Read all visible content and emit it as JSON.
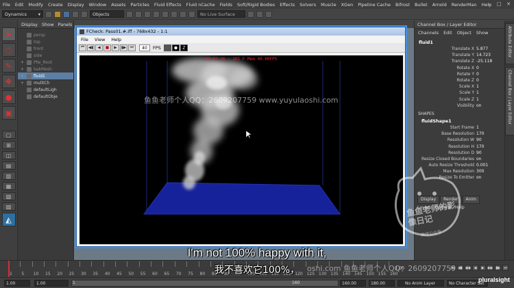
{
  "menubar": {
    "items": [
      "File",
      "Edit",
      "Modify",
      "Create",
      "Display",
      "Window",
      "Assets",
      "Particles",
      "Fluid Effects",
      "Fluid nCache",
      "Fields",
      "Soft/Rigid Bodies",
      "Effects",
      "Solvers",
      "Muscle",
      "XGen",
      "Pipeline Cache",
      "Bifrost",
      "Bullet",
      "Arnold",
      "RenderMan",
      "Help"
    ]
  },
  "statusline": {
    "menuset": "Dynamics",
    "selection_mode": "Objects",
    "live_surface": "No Live Surface"
  },
  "outliner": {
    "menu": [
      "Display",
      "Show",
      "Panels"
    ],
    "items": [
      {
        "label": "persp",
        "dim": true
      },
      {
        "label": "top",
        "dim": true
      },
      {
        "label": "front",
        "dim": true
      },
      {
        "label": "side",
        "dim": true
      },
      {
        "label": "Pfw_Root",
        "dim": true
      },
      {
        "label": "bakMesh",
        "dim": true
      },
      {
        "label": "fluid1",
        "dim": false
      },
      {
        "label": "mulitCh",
        "dim": false
      },
      {
        "label": "defaultLigh",
        "dim": false
      },
      {
        "label": "defaultObje",
        "dim": false
      }
    ]
  },
  "fcheck": {
    "title": "FCheck: Pass01.#.iff - 768x432 - 1:1",
    "menu": [
      "File",
      "View",
      "Help"
    ],
    "fps_value": "40",
    "fps_label": "FPS",
    "info": "00:02:26 - 101 F Mem 40.00FPS"
  },
  "channelbox": {
    "header": "Channel Box / Layer Editor",
    "menu": [
      "Channels",
      "Edit",
      "Object",
      "Show"
    ],
    "node": "fluid1",
    "attrs": [
      {
        "label": "Translate X",
        "value": "5.877"
      },
      {
        "label": "Translate Y",
        "value": "14.723"
      },
      {
        "label": "Translate Z",
        "value": "-25.118"
      },
      {
        "label": "Rotate X",
        "value": "0"
      },
      {
        "label": "Rotate Y",
        "value": "0"
      },
      {
        "label": "Rotate Z",
        "value": "0"
      },
      {
        "label": "Scale X",
        "value": "1"
      },
      {
        "label": "Scale Y",
        "value": "1"
      },
      {
        "label": "Scale Z",
        "value": "1"
      },
      {
        "label": "Visibility",
        "value": "on"
      }
    ],
    "shapes_label": "SHAPES",
    "shape_node": "fluidShape1",
    "shape_attrs": [
      {
        "label": "Start Frame",
        "value": "1"
      },
      {
        "label": "Base Resolution",
        "value": "170"
      },
      {
        "label": "Resolution W",
        "value": "90"
      },
      {
        "label": "Resolution H",
        "value": "170"
      },
      {
        "label": "Resolution D",
        "value": "90"
      },
      {
        "label": "Resize Closed Boundaries",
        "value": "on"
      },
      {
        "label": "Auto Resize Threshold",
        "value": "0.001"
      },
      {
        "label": "Max Resolution",
        "value": "300"
      },
      {
        "label": "Resize To Emitter",
        "value": "on"
      }
    ],
    "tabs": [
      "Display",
      "Render",
      "Anim"
    ],
    "layer_menu": [
      "Layers",
      "Options",
      "Help"
    ]
  },
  "vtabs": [
    "Attribute Editor",
    "Channel Box / Layer Editor"
  ],
  "timeline": {
    "ticks": [
      "1",
      "5",
      "10",
      "15",
      "20",
      "25",
      "30",
      "35",
      "40",
      "45",
      "50",
      "55",
      "60",
      "65",
      "70",
      "75",
      "80",
      "85",
      "90",
      "95",
      "100",
      "105",
      "110",
      "115",
      "120",
      "125",
      "130",
      "135",
      "140",
      "145",
      "150",
      "155",
      "160"
    ],
    "current_frame": "1.00"
  },
  "range": {
    "start": "1.00",
    "playback_start": "1.00",
    "slider_start": "1",
    "slider_end": "160",
    "playback_end": "160.00",
    "end": "180.00",
    "anim_layer": "No Anim Layer",
    "char_set": "No Character Set"
  },
  "overlay": {
    "watermark1": "鱼鱼老师个人QQ：2609207759 www.yuyulaoshi.com",
    "watermark2": "oshi.com  鱼鱼老师个人QQ：2609207759",
    "subtitle_en": "I'm not 100% happy with it,",
    "subtitle_zh": "我不喜欢它100%，",
    "brand": "pluralsight",
    "stamp_text": "鱼鱼老师的影像日记",
    "stamp_sub": "微信公众号"
  },
  "colors": {
    "accent": "#4a90d9",
    "fluid_plane": "#16229a",
    "selection": "#5d7fa6"
  }
}
